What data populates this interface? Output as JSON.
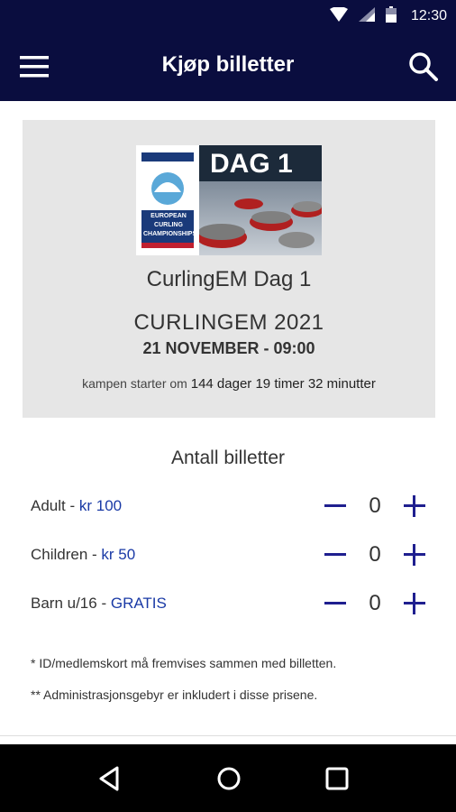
{
  "status_bar": {
    "time": "12:30",
    "icons": [
      "wifi-icon",
      "signal-icon",
      "battery-icon"
    ]
  },
  "app_bar": {
    "title": "Kjøp billetter",
    "menu_icon": "menu-icon",
    "search_icon": "search-icon"
  },
  "event": {
    "image_overlay_text": "DAG 1",
    "image_logo_text": "EUROPEAN CURLING CHAMPIONSHIPS",
    "title": "CurlingEM Dag 1",
    "organizer": "CURLINGEM 2021",
    "date": "21 NOVEMBER - 09:00",
    "countdown_prefix": "kampen starter om",
    "countdown_value": "144 dager 19 timer 32 minutter"
  },
  "tickets": {
    "heading": "Antall billetter",
    "items": [
      {
        "name": "Adult",
        "separator": " - ",
        "price": "kr 100",
        "quantity": "0"
      },
      {
        "name": "Children",
        "separator": " - ",
        "price": "kr 50",
        "quantity": "0"
      },
      {
        "name": "Barn u/16",
        "separator": " - ",
        "price": "GRATIS",
        "quantity": "0"
      }
    ]
  },
  "notes": [
    "* ID/medlemskort må fremvises sammen med billetten.",
    "** Administrasjonsgebyr er inkludert i disse prisene."
  ],
  "nav_bar": {
    "icons": [
      "back-icon",
      "home-icon",
      "recents-icon"
    ]
  },
  "colors": {
    "header": "#0a0d3f",
    "accent": "#1f1f8f",
    "price": "#1a3aa6",
    "card": "#e6e6e6"
  }
}
